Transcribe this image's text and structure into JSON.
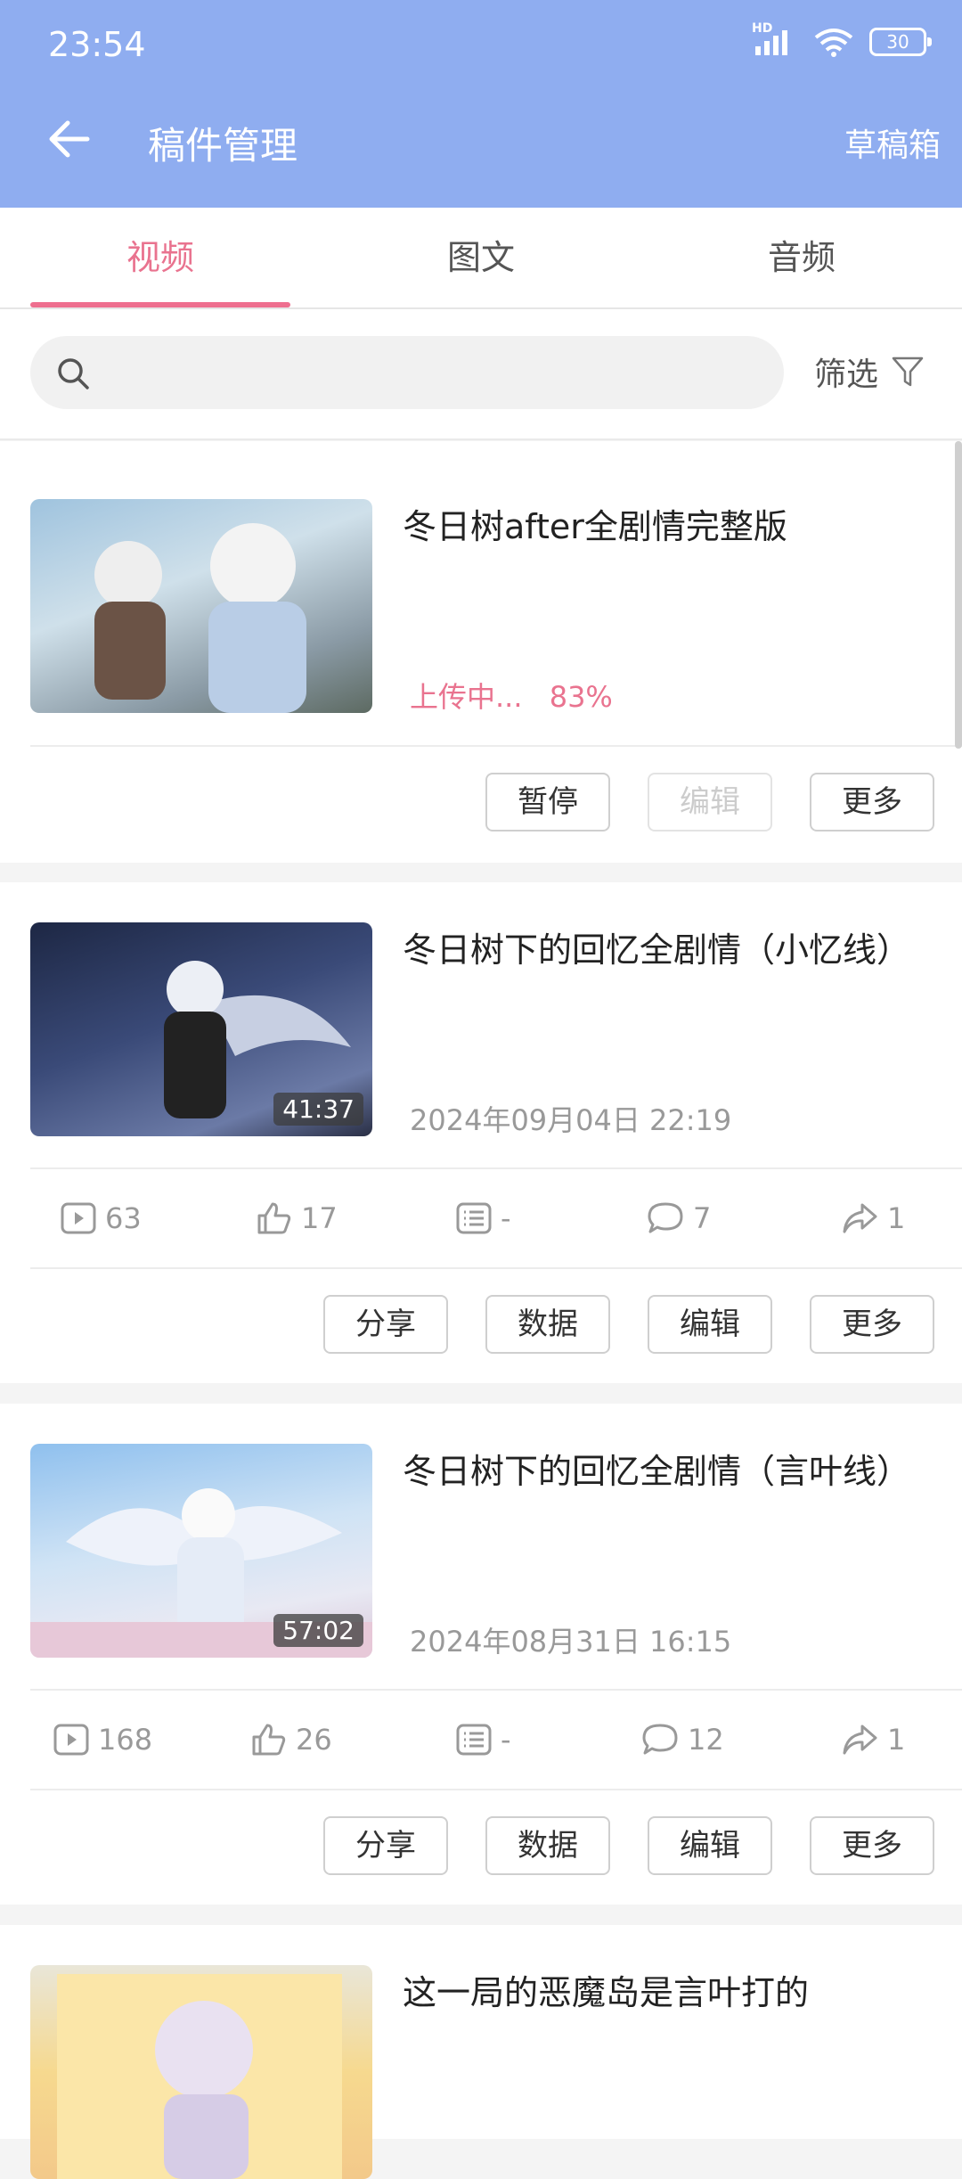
{
  "status_bar": {
    "time": "23:54",
    "hd_label": "HD",
    "battery": "30"
  },
  "header": {
    "title": "稿件管理",
    "drafts_label": "草稿箱"
  },
  "tabs": [
    {
      "label": "视频",
      "active": true
    },
    {
      "label": "图文",
      "active": false
    },
    {
      "label": "音频",
      "active": false
    }
  ],
  "search": {
    "placeholder": "",
    "filter_label": "筛选"
  },
  "videos": [
    {
      "title": "冬日树after全剧情完整版",
      "status_text": "上传中...",
      "progress": "83%",
      "buttons": [
        "暂停",
        "编辑",
        "更多"
      ]
    },
    {
      "title": "冬日树下的回忆全剧情（小忆线）",
      "duration": "41:37",
      "date": "2024年09月04日  22:19",
      "stats": {
        "plays": "63",
        "likes": "17",
        "danmaku": "-",
        "comments": "7",
        "shares": "1"
      },
      "buttons": [
        "分享",
        "数据",
        "编辑",
        "更多"
      ]
    },
    {
      "title": "冬日树下的回忆全剧情（言叶线）",
      "duration": "57:02",
      "date": "2024年08月31日  16:15",
      "stats": {
        "plays": "168",
        "likes": "26",
        "danmaku": "-",
        "comments": "12",
        "shares": "1"
      },
      "buttons": [
        "分享",
        "数据",
        "编辑",
        "更多"
      ]
    },
    {
      "title": "这一局的恶魔岛是言叶打的"
    }
  ]
}
